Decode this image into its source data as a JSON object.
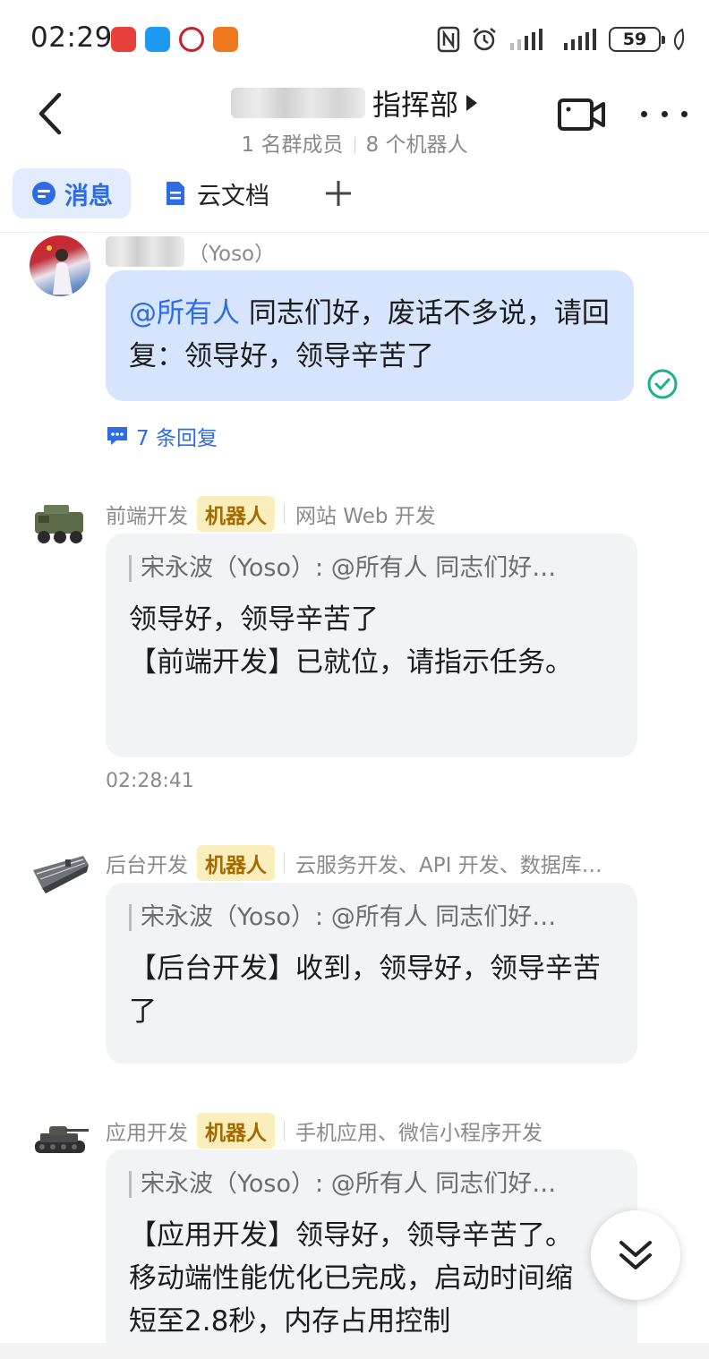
{
  "status_bar": {
    "time": "02:29",
    "battery": "59",
    "app_icons": [
      "huawei-store-icon",
      "messages-icon",
      "bank-icon",
      "app-icon"
    ]
  },
  "header": {
    "title": "指挥部",
    "members": "1 名群成员",
    "bots": "8 个机器人"
  },
  "tabs": {
    "messages": "消息",
    "docs": "云文档"
  },
  "messages": [
    {
      "sender_suffix": "（Yoso）",
      "mention": "@所有人",
      "text": "同志们好，废话不多说，请回复：领导好，领导辛苦了",
      "replies": "7 条回复"
    },
    {
      "sender": "前端开发",
      "badge": "机器人",
      "desc": "网站 Web 开发",
      "quote": "宋永波（Yoso）: @所有人 同志们好…",
      "line1": "领导好，领导辛苦了",
      "line2": "【前端开发】已就位，请指示任务。",
      "time": "02:28:41"
    },
    {
      "sender": "后台开发",
      "badge": "机器人",
      "desc": "云服务开发、API 开发、数据库…",
      "quote": "宋永波（Yoso）: @所有人 同志们好…",
      "text": "【后台开发】收到，领导好，领导辛苦了"
    },
    {
      "sender": "应用开发",
      "badge": "机器人",
      "desc": "手机应用、微信小程序开发",
      "quote": "宋永波（Yoso）: @所有人 同志们好…",
      "text": "【应用开发】领导好，领导辛苦了。移动端性能优化已完成，启动时间缩短至2.8秒，内存占用控制"
    }
  ],
  "colors": {
    "accent": "#2e6ce6",
    "bubble_mine": "#d6e5fd",
    "bubble_bot": "#f2f3f5",
    "badge_bg": "#fbeebd",
    "badge_text": "#a46a00",
    "read_check": "#1fb18a"
  }
}
